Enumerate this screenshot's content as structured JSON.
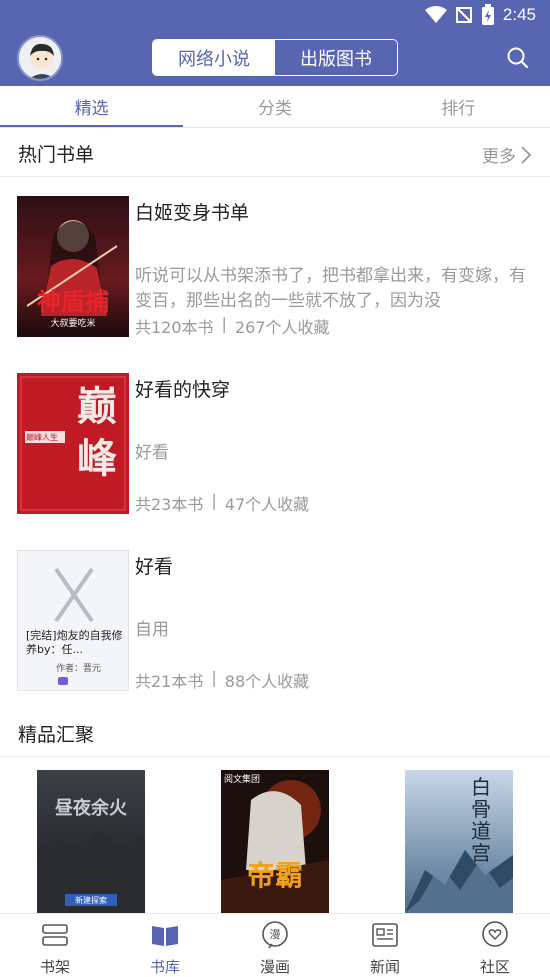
{
  "status_bar": {
    "time": "2:45"
  },
  "header": {
    "segments": [
      {
        "label": "网络小说",
        "active": true
      },
      {
        "label": "出版图书",
        "active": false
      }
    ]
  },
  "tabs": [
    {
      "label": "精选",
      "active": true
    },
    {
      "label": "分类",
      "active": false
    },
    {
      "label": "排行",
      "active": false
    }
  ],
  "hot_lists": {
    "title": "热门书单",
    "more_label": "更多",
    "items": [
      {
        "title": "白姬变身书单",
        "description": "听说可以从书架添书了，把书都拿出来，有变嫁，有变百，那些出名的一些就不放了，因为没",
        "count": "共120本书",
        "favorites": "267个人收藏",
        "cover_text": "神盾捕",
        "cover_sub": "大叔要吃米"
      },
      {
        "title": "好看的快穿",
        "description": "好看",
        "count": "共23本书",
        "favorites": "47个人收藏",
        "cover_text": "巅峰",
        "cover_sub": "巅峰人生"
      },
      {
        "title": "好看",
        "description": "自用",
        "count": "共21本书",
        "favorites": "88个人收藏",
        "cover_text": "[完结]炮友的自我修养by：任...",
        "cover_sub": "作者：晋元"
      }
    ]
  },
  "featured": {
    "title": "精品汇聚",
    "covers": [
      {
        "text": "昼夜余火",
        "badge": "新建探索"
      },
      {
        "text": "帝霸",
        "badge": "阅文集团"
      },
      {
        "text": "白骨道宫",
        "badge": ""
      }
    ]
  },
  "bottom_nav": [
    {
      "label": "书架",
      "icon": "bookshelf-icon",
      "active": false
    },
    {
      "label": "书库",
      "icon": "open-book-icon",
      "active": true
    },
    {
      "label": "漫画",
      "icon": "comic-icon",
      "active": false
    },
    {
      "label": "新闻",
      "icon": "newspaper-icon",
      "active": false
    },
    {
      "label": "社区",
      "icon": "heart-chat-icon",
      "active": false
    }
  ],
  "colors": {
    "primary": "#5866b2",
    "muted": "#9a9a9a",
    "text": "#222222"
  }
}
